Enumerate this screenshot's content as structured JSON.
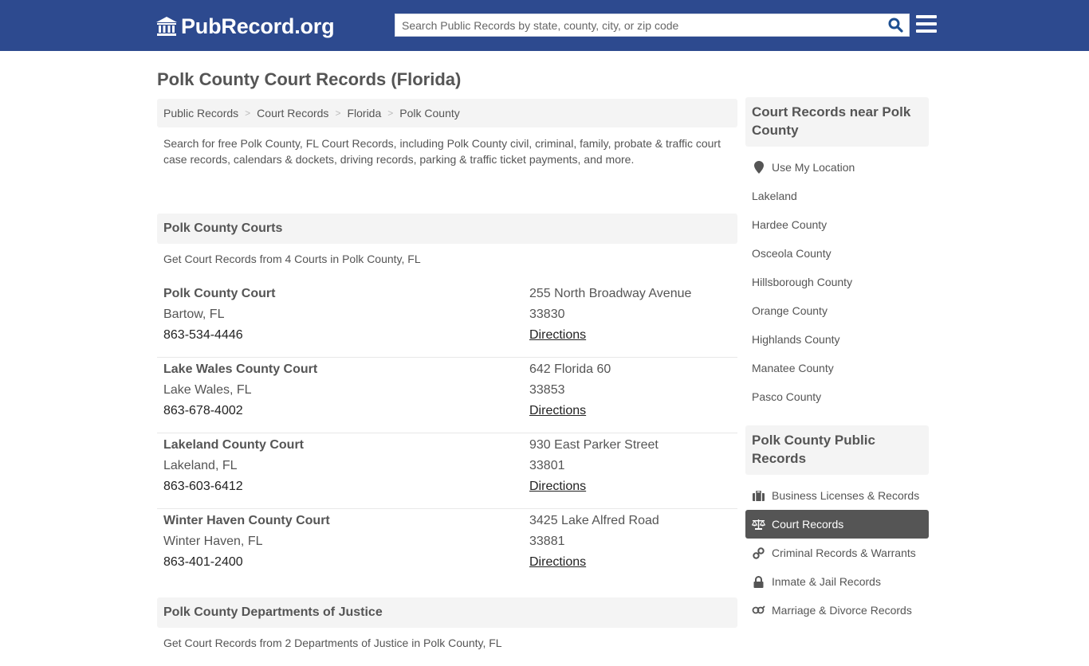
{
  "header": {
    "logo_text": "PubRecord.org",
    "search_placeholder": "Search Public Records by state, county, city, or zip code",
    "colors": {
      "topbar": "#2d4a8f",
      "search_icon": "#1d4f91"
    }
  },
  "page": {
    "title": "Polk County Court Records (Florida)"
  },
  "breadcrumb": [
    {
      "label": "Public Records"
    },
    {
      "label": "Court Records"
    },
    {
      "label": "Florida"
    },
    {
      "label": "Polk County"
    }
  ],
  "breadcrumb_separator": ">",
  "intro": "Search for free Polk County, FL Court Records, including Polk County civil, criminal, family, probate & traffic court case records, calendars & dockets, driving records, parking & traffic ticket payments, and more.",
  "courts_section": {
    "title": "Polk County Courts",
    "subtitle": "Get Court Records from 4 Courts in Polk County, FL",
    "items": [
      {
        "name": "Polk County Court",
        "city": "Bartow, FL",
        "phone": "863-534-4446",
        "address": "255 North Broadway Avenue",
        "zip": "33830",
        "link": "Directions"
      },
      {
        "name": "Lake Wales County Court",
        "city": "Lake Wales, FL",
        "phone": "863-678-4002",
        "address": "642 Florida 60",
        "zip": "33853",
        "link": "Directions"
      },
      {
        "name": "Lakeland County Court",
        "city": "Lakeland, FL",
        "phone": "863-603-6412",
        "address": "930 East Parker Street",
        "zip": "33801",
        "link": "Directions"
      },
      {
        "name": "Winter Haven County Court",
        "city": "Winter Haven, FL",
        "phone": "863-401-2400",
        "address": "3425 Lake Alfred Road",
        "zip": "33881",
        "link": "Directions"
      }
    ]
  },
  "justice_section": {
    "title": "Polk County Departments of Justice",
    "subtitle": "Get Court Records from 2 Departments of Justice in Polk County, FL"
  },
  "sidebar": {
    "nearby": {
      "title": "Court Records near Polk County",
      "items": [
        {
          "label": "Use My Location",
          "icon": "map-marker-icon"
        },
        {
          "label": "Lakeland"
        },
        {
          "label": "Hardee County"
        },
        {
          "label": "Osceola County"
        },
        {
          "label": "Hillsborough County"
        },
        {
          "label": "Orange County"
        },
        {
          "label": "Highlands County"
        },
        {
          "label": "Manatee County"
        },
        {
          "label": "Pasco County"
        }
      ]
    },
    "public_records": {
      "title": "Polk County Public Records",
      "items": [
        {
          "label": "Business Licenses & Records",
          "icon": "briefcase-icon"
        },
        {
          "label": "Court Records",
          "icon": "scales-icon",
          "active": true
        },
        {
          "label": "Criminal Records & Warrants",
          "icon": "handcuffs-icon"
        },
        {
          "label": "Inmate & Jail Records",
          "icon": "lock-icon"
        },
        {
          "label": "Marriage & Divorce Records",
          "icon": "gender-icon"
        }
      ]
    }
  }
}
